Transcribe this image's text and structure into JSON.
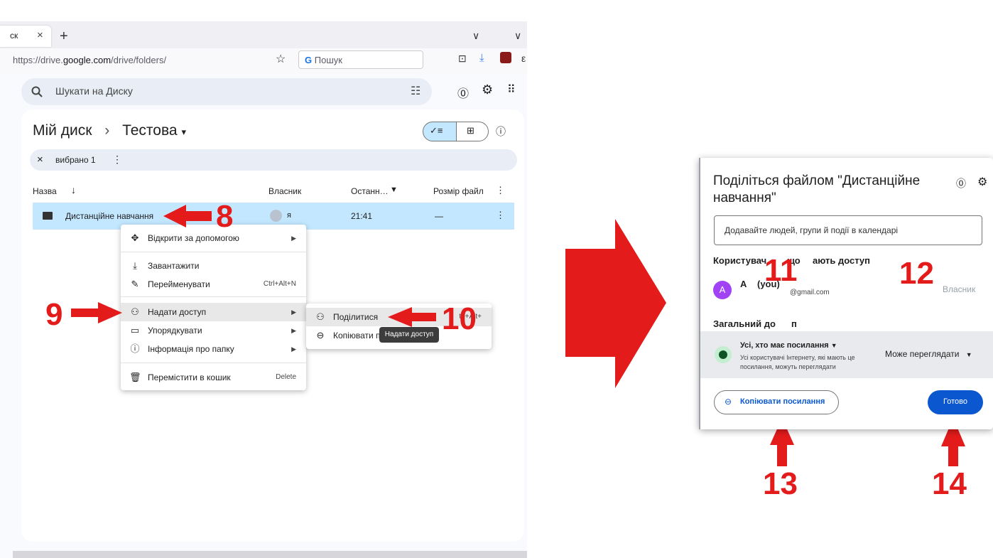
{
  "browser": {
    "tab_label": "ск",
    "tab_close": "×",
    "new_tab": "+",
    "tab_list": "∨",
    "url_prefix": "https://drive.",
    "url_domain": "google.com",
    "url_path": "/drive/folders/",
    "search_placeholder": "Пошук"
  },
  "drive": {
    "search_placeholder": "Шукати на Диску",
    "breadcrumb_root": "Мій диск",
    "breadcrumb_sep": "›",
    "breadcrumb_current": "Тестова",
    "selection_count": "вибрано 1",
    "columns": [
      "Назва",
      "Власник",
      "Останн…",
      "Розмір файл"
    ],
    "rows": [
      {
        "name": "Дистанційне навчання",
        "owner": "я",
        "modified": "21:41",
        "size": "—"
      }
    ]
  },
  "context_menu": {
    "items": [
      {
        "label": "Відкрити за допомогою",
        "icon": "move-icon",
        "shortcut": "",
        "submenu": true
      },
      {
        "label": "Завантажити",
        "icon": "download-icon",
        "shortcut": "",
        "submenu": false
      },
      {
        "label": "Перейменувати",
        "icon": "edit-icon",
        "shortcut": "Ctrl+Alt+N",
        "submenu": false
      },
      {
        "label": "Надати доступ",
        "icon": "person-add-icon",
        "shortcut": "",
        "submenu": true
      },
      {
        "label": "Упорядкувати",
        "icon": "folder-icon",
        "shortcut": "",
        "submenu": true
      },
      {
        "label": "Інформація про папку",
        "icon": "info-icon",
        "shortcut": "",
        "submenu": true
      },
      {
        "label": "Перемістити в кошик",
        "icon": "trash-icon",
        "shortcut": "Delete",
        "submenu": false
      }
    ],
    "submenu": [
      {
        "label": "Поділитися",
        "shortcut": "trl+Alt+"
      },
      {
        "label": "Копіювати п"
      }
    ],
    "tooltip": "Надати доступ"
  },
  "annotations": [
    "8",
    "9",
    "10",
    "11",
    "12",
    "13",
    "14"
  ],
  "share_dialog": {
    "title": "Поділіться файлом \"Дистанційне навчання\"",
    "title_line1": "Поділіться файлом \"Дистанційне",
    "title_line2": "навчання\"",
    "add_people_placeholder": "Додавайте людей, групи й події в календарі",
    "people_heading_left": "Користувач",
    "people_heading_mid": "що",
    "people_heading_right": "ають доступ",
    "user_avatar": "A",
    "user_name": "A",
    "user_you": "(you)",
    "user_email": "@gmail.com",
    "user_role": "Власник",
    "general_heading_left": "Загальний до",
    "general_heading_right": "п",
    "access_label": "Усі, хто має посилання",
    "access_desc_1": "Усі користувачі Інтернету, які мають це",
    "access_desc_2": "посилання, можуть переглядати",
    "role_label": "Може переглядати",
    "copy_link": "Копіювати посилання",
    "done": "Готово"
  },
  "colors": {
    "arrow_red": "#e31b1b",
    "accent_blue": "#0b57d0",
    "selection_blue": "#c2e7ff"
  }
}
